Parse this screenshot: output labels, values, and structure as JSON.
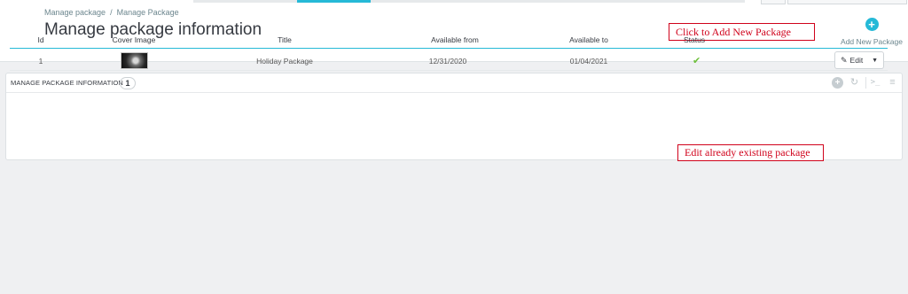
{
  "breadcrumb": {
    "parent": "Manage package",
    "separator": "/",
    "current": "Manage Package"
  },
  "page_title": "Manage package information",
  "annotations": {
    "add": "Click to Add New Package",
    "edit": "Edit already existing package"
  },
  "toolbar": {
    "add_icon": "plus-circle-icon",
    "add_label": "Add New Package"
  },
  "panel": {
    "title": "MANAGE PACKAGE INFORMATION",
    "count": "1",
    "tool_icons": [
      "plus-circle-icon",
      "refresh-icon",
      "terminal-icon",
      "database-icon"
    ]
  },
  "table": {
    "columns": {
      "id": "Id",
      "cover": "Cover Image",
      "title": "Title",
      "from": "Available from",
      "to": "Available to",
      "status": "Status"
    },
    "rows": [
      {
        "id": "1",
        "cover_icon": "cover-image-thumbnail",
        "title": "Holiday Package",
        "from": "12/31/2020",
        "to": "01/04/2021",
        "status_icon": "check-icon",
        "status_color": "#6cbf3a",
        "edit_label": "Edit"
      }
    ]
  },
  "colors": {
    "accent": "#25b9d7",
    "annotation": "#d0021b"
  }
}
